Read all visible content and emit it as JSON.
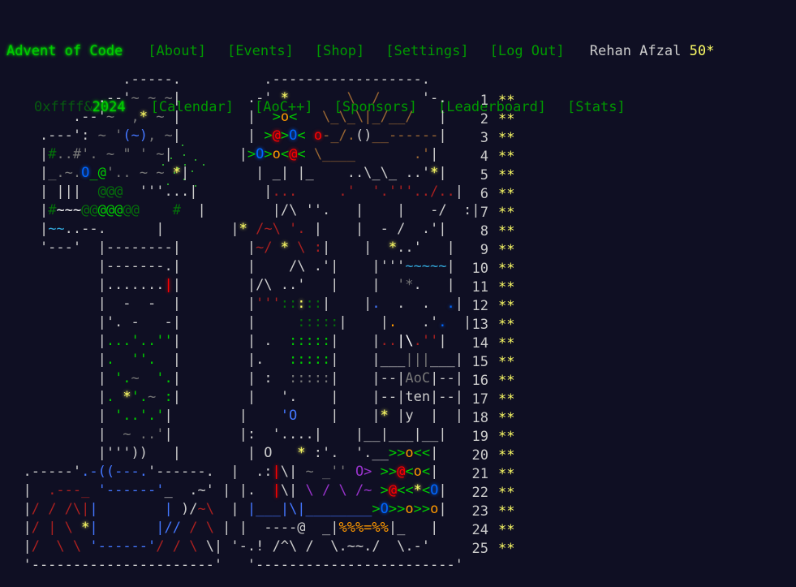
{
  "header": {
    "logo": "Advent of Code",
    "year_prefix": "0xffff&",
    "year": "2024",
    "nav_top": [
      "[About]",
      "[Events]",
      "[Shop]",
      "[Settings]",
      "[Log Out]"
    ],
    "nav_bottom": [
      "[Calendar]",
      "[AoC++]",
      "[Sponsors]",
      "[Leaderboard]",
      "[Stats]"
    ],
    "user_name": "Rehan Afzal",
    "user_stars": "50*"
  },
  "days": [
    {
      "number": "1",
      "stars": "**"
    },
    {
      "number": "2",
      "stars": "**"
    },
    {
      "number": "3",
      "stars": "**"
    },
    {
      "number": "4",
      "stars": "**"
    },
    {
      "number": "5",
      "stars": "**"
    },
    {
      "number": "6",
      "stars": "**"
    },
    {
      "number": "7",
      "stars": "**"
    },
    {
      "number": "8",
      "stars": "**"
    },
    {
      "number": "9",
      "stars": "**"
    },
    {
      "number": "10",
      "stars": "**"
    },
    {
      "number": "11",
      "stars": "**"
    },
    {
      "number": "12",
      "stars": "**"
    },
    {
      "number": "13",
      "stars": "**"
    },
    {
      "number": "14",
      "stars": "**"
    },
    {
      "number": "15",
      "stars": "**"
    },
    {
      "number": "16",
      "stars": "**"
    },
    {
      "number": "17",
      "stars": "**"
    },
    {
      "number": "18",
      "stars": "**"
    },
    {
      "number": "19",
      "stars": "**"
    },
    {
      "number": "20",
      "stars": "**"
    },
    {
      "number": "21",
      "stars": "**"
    },
    {
      "number": "22",
      "stars": "**"
    },
    {
      "number": "23",
      "stars": "**"
    },
    {
      "number": "24",
      "stars": "**"
    },
    {
      "number": "25",
      "stars": "**"
    }
  ],
  "art": {
    "aoc_box": [
      "AoC",
      "ten",
      "y"
    ]
  },
  "colors": {
    "background": "#0f0f23",
    "text": "#cccccc",
    "logo_green": "#00cc00",
    "link_green": "#009900",
    "star_yellow": "#ffff66"
  }
}
